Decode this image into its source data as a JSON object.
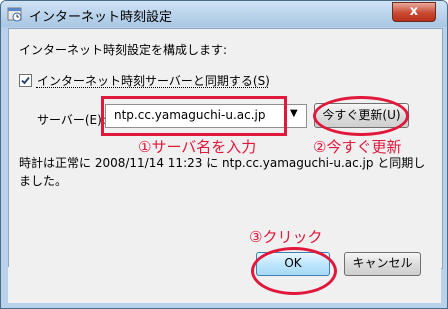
{
  "window": {
    "title": "インターネット時刻設定",
    "close_glyph": "x"
  },
  "main": {
    "heading": "インターネット時刻設定を構成します:",
    "sync_checkbox": {
      "checked": true,
      "label": "インターネット時刻サーバーと同期する(S)"
    },
    "server_label": "サーバー(E):",
    "server_value": "ntp.cc.yamaguchi-u.ac.jp",
    "update_now_label": "今すぐ更新(U)",
    "status_line1": "時計は正常に 2008/11/14 11:23 に ntp.cc.yamaguchi-u.ac.jp と同期し",
    "status_line2": "ました。"
  },
  "footer": {
    "ok_label": "OK",
    "cancel_label": "キャンセル"
  },
  "annotations": {
    "step1": "①サーバ名を入力",
    "step2": "②今すぐ更新",
    "step3": "③クリック",
    "color": "#e0183c"
  }
}
